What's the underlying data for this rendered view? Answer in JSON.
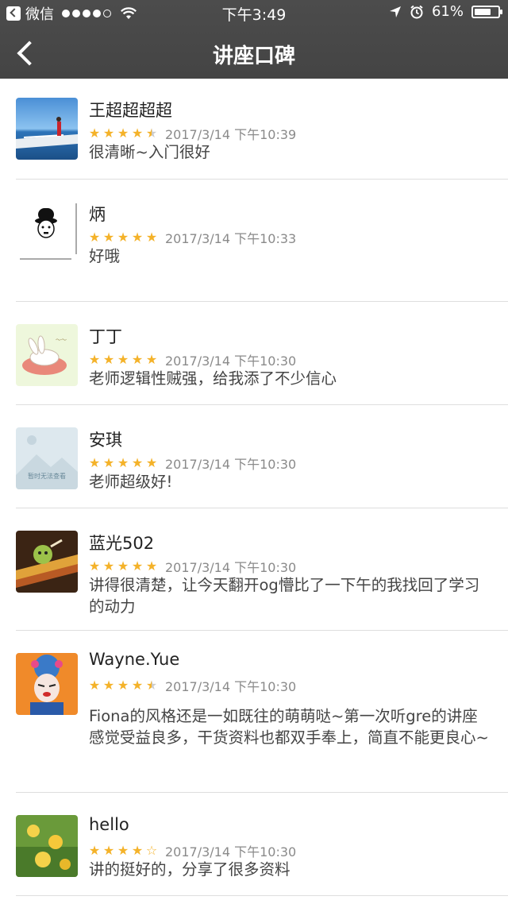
{
  "status_bar": {
    "carrier": "微信",
    "time": "下午3:49",
    "battery": "61%"
  },
  "nav": {
    "title": "讲座口碑"
  },
  "reviews": [
    {
      "name": "王超超超超",
      "rating": 4.5,
      "stars": [
        "full",
        "full",
        "full",
        "full",
        "half"
      ],
      "date": "2017/3/14 下午10:39",
      "text": "很清晰~入门很好"
    },
    {
      "name": "炳",
      "rating": 5,
      "stars": [
        "full",
        "full",
        "full",
        "full",
        "full"
      ],
      "date": "2017/3/14 下午10:33",
      "text": "好哦"
    },
    {
      "name": "丁丁",
      "rating": 5,
      "stars": [
        "full",
        "full",
        "full",
        "full",
        "full"
      ],
      "date": "2017/3/14 下午10:30",
      "text": "老师逻辑性贼强，给我添了不少信心"
    },
    {
      "name": "安琪",
      "rating": 5,
      "stars": [
        "full",
        "full",
        "full",
        "full",
        "full"
      ],
      "date": "2017/3/14 下午10:30",
      "text": "老师超级好!",
      "avatar_caption": "暂时无法查看"
    },
    {
      "name": "蓝光502",
      "rating": 5,
      "stars": [
        "full",
        "full",
        "full",
        "full",
        "full"
      ],
      "date": "2017/3/14 下午10:30",
      "text": "讲得很清楚，让今天翻开og懵比了一下午的我找回了学习的动力"
    },
    {
      "name": "Wayne.Yue",
      "rating": 4.5,
      "stars": [
        "full",
        "full",
        "full",
        "full",
        "half"
      ],
      "date": "2017/3/14 下午10:30",
      "text": "Fiona的风格还是一如既往的萌萌哒~第一次听gre的讲座感觉受益良多，干货资料也都双手奉上，简直不能更良心~"
    },
    {
      "name": "hello",
      "rating": 4,
      "stars": [
        "full",
        "full",
        "full",
        "full",
        "empty"
      ],
      "date": "2017/3/14 下午10:30",
      "text": "讲的挺好的，分享了很多资料"
    }
  ],
  "colors": {
    "nav_bg": "#4a4a4a",
    "star": "#f4b229",
    "divider": "#dedede"
  }
}
